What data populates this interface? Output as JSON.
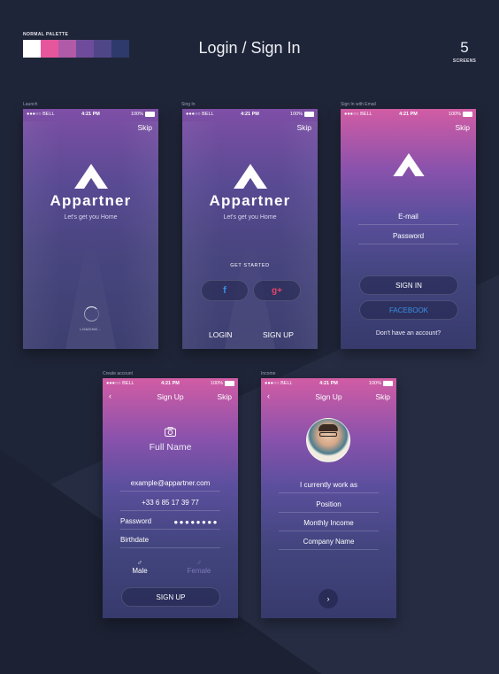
{
  "header": {
    "palette_label": "NORMAL PALETTE",
    "palette_colors": [
      "#ffffff",
      "#e6569d",
      "#b05aa8",
      "#6f4c9b",
      "#4e4686",
      "#2e3a6b"
    ],
    "title": "Login / Sign In",
    "count": "5",
    "count_label": "SCREENS"
  },
  "status_bar": {
    "carrier": "●●●○○ BELL",
    "time": "4:21 PM",
    "battery": "100%"
  },
  "launch": {
    "label": "Launch",
    "skip": "Skip",
    "brand": "Appartner",
    "tagline": "Let's get you Home",
    "loading": "LOADING..."
  },
  "sign_in": {
    "label": "Sing In",
    "skip": "Skip",
    "brand": "Appartner",
    "tagline": "Let's get you Home",
    "get_started": "GET STARTED",
    "facebook_icon": "f",
    "google_icon": "g+",
    "login": "LOGIN",
    "sign_up": "SIGN UP"
  },
  "sign_in_email": {
    "label": "Sign In with Email",
    "skip": "Skip",
    "email": "E-mail",
    "password": "Password",
    "sign_in_button": "SIGN IN",
    "facebook_button": "FACEBOOK",
    "no_account": "Don't have an account?"
  },
  "create_account": {
    "label": "Create account",
    "back": "‹",
    "title": "Sign Up",
    "skip": "Skip",
    "full_name": "Full Name",
    "email": "example@appartner.com",
    "phone": "+33 6 85 17 39 77",
    "password_label": "Password",
    "password_dots": "●●●●●●●●",
    "birthdate": "Birthdate",
    "male_symbol": "♂",
    "male": "Male",
    "female_symbol": "♂",
    "female": "Female",
    "sign_up_button": "SIGN UP"
  },
  "income": {
    "label": "Income",
    "back": "‹",
    "title": "Sign Up",
    "skip": "Skip",
    "work_as": "I currently work as",
    "position": "Position",
    "monthly_income": "Monthly Income",
    "company_name": "Company Name",
    "next": "›"
  }
}
